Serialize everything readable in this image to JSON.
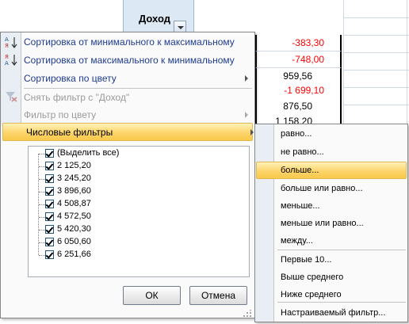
{
  "column": {
    "header": "Доход"
  },
  "cells": [
    {
      "value": "-383,30",
      "negative": true
    },
    {
      "value": "-748,00",
      "negative": true
    },
    {
      "value": "959,56",
      "negative": false
    },
    {
      "value": "-1 699,10",
      "negative": true
    },
    {
      "value": "876,50",
      "negative": false
    },
    {
      "value": "1 158,20",
      "negative": false
    }
  ],
  "menu": {
    "sort_asc": "Сортировка от минимального к максимальному",
    "sort_desc": "Сортировка от максимального к минимальному",
    "sort_color": "Сортировка по цвету",
    "clear_filter": "Снять фильтр с \"Доход\"",
    "filter_color": "Фильтр по цвету",
    "number_filters": "Числовые фильтры"
  },
  "list": {
    "select_all": "(Выделить все)",
    "items": [
      "2 125,20",
      "3 245,20",
      "3 896,60",
      "4 508,87",
      "4 572,50",
      "5 420,30",
      "6 050,60",
      "6 251,66"
    ]
  },
  "buttons": {
    "ok": "ОК",
    "cancel": "Отмена"
  },
  "submenu": {
    "items": [
      "равно...",
      "не равно...",
      "больше...",
      "больше или равно...",
      "меньше...",
      "меньше или равно...",
      "между...",
      "Первые 10...",
      "Выше среднего",
      "Ниже среднего",
      "Настраиваемый фильтр..."
    ],
    "highlighted": "больше..."
  },
  "colors": {
    "negative": "#ff0000",
    "menu_text": "#1f3b8f",
    "highlight": "#fcd46b"
  }
}
